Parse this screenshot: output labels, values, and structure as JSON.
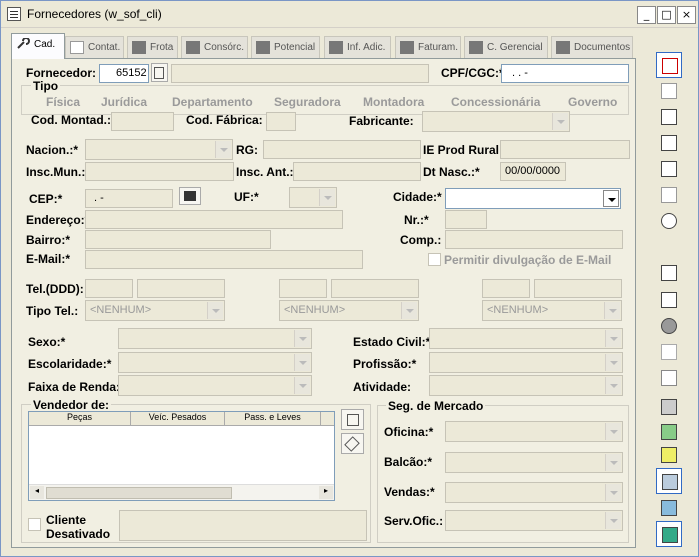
{
  "window": {
    "title": "Fornecedores (w_sof_cli)",
    "min": "_",
    "max": "□",
    "close": "×"
  },
  "tabs": [
    {
      "label": "Cad.",
      "active": true
    },
    {
      "label": "Contat."
    },
    {
      "label": "Frota"
    },
    {
      "label": "Consórc."
    },
    {
      "label": "Potencial"
    },
    {
      "label": "Inf. Adic."
    },
    {
      "label": "Faturam."
    },
    {
      "label": "C. Gerencial"
    },
    {
      "label": "Documentos"
    }
  ],
  "form": {
    "fornecedor_label": "Fornecedor:",
    "fornecedor_value": "65152",
    "cpf_label": "CPF/CGC:*",
    "cpf_value": ".   .   -",
    "tipo_label": "Tipo",
    "tipo_options": [
      "Física",
      "Jurídica",
      "Departamento",
      "Seguradora",
      "Montadora",
      "Concessionária",
      "Governo"
    ],
    "cod_montad_label": "Cod. Montad.:",
    "cod_fabrica_label": "Cod. Fábrica:",
    "fabricante_label": "Fabricante:",
    "nacion_label": "Nacion.:*",
    "rg_label": "RG:",
    "ie_prod_label": "IE Prod Rural:",
    "insc_mun_label": "Insc.Mun.:",
    "insc_ant_label": "Insc. Ant.:",
    "dt_nasc_label": "Dt Nasc.:*",
    "dt_nasc_value": "00/00/0000",
    "cep_label": "CEP:*",
    "cep_value": ".   -",
    "uf_label": "UF:*",
    "cidade_label": "Cidade:*",
    "endereco_label": "Endereço:*",
    "nr_label": "Nr.:*",
    "bairro_label": "Bairro:*",
    "comp_label": "Comp.:",
    "email_label": "E-Mail:*",
    "permitir_label": "Permitir divulgação de E-Mail",
    "tel_label": "Tel.(DDD):",
    "tipo_tel_label": "Tipo Tel.:",
    "nenhum": "<NENHUM>",
    "sexo_label": "Sexo:*",
    "estado_civil_label": "Estado Civil:*",
    "escolaridade_label": "Escolaridade:*",
    "profissao_label": "Profissão:*",
    "faixa_renda_label": "Faixa de Renda:",
    "atividade_label": "Atividade:",
    "vendedor_label": "Vendedor de:",
    "vendedor_cols": [
      "Peças",
      "Veíc. Pesados",
      "Pass. e Leves"
    ],
    "seg_mercado_label": "Seg. de Mercado",
    "oficina_label": "Oficina:*",
    "balcao_label": "Balcão:*",
    "vendas_label": "Vendas:*",
    "serv_ofic_label": "Serv.Ofic.:",
    "cliente_desativado_label1": "Cliente",
    "cliente_desativado_label2": "Desativado"
  },
  "toolbar_icons": [
    "add-row-icon",
    "grid-icon",
    "hand-icon",
    "person-icon",
    "eraser-icon",
    "search-doc-icon",
    "refresh-icon",
    "document-icon",
    "point-hand-icon",
    "stop-icon",
    "copy-icon",
    "print-icon",
    "group-icon",
    "green-doc-icon",
    "yellow-doc-icon",
    "monitor-icon",
    "export-icon",
    "exit-icon"
  ]
}
